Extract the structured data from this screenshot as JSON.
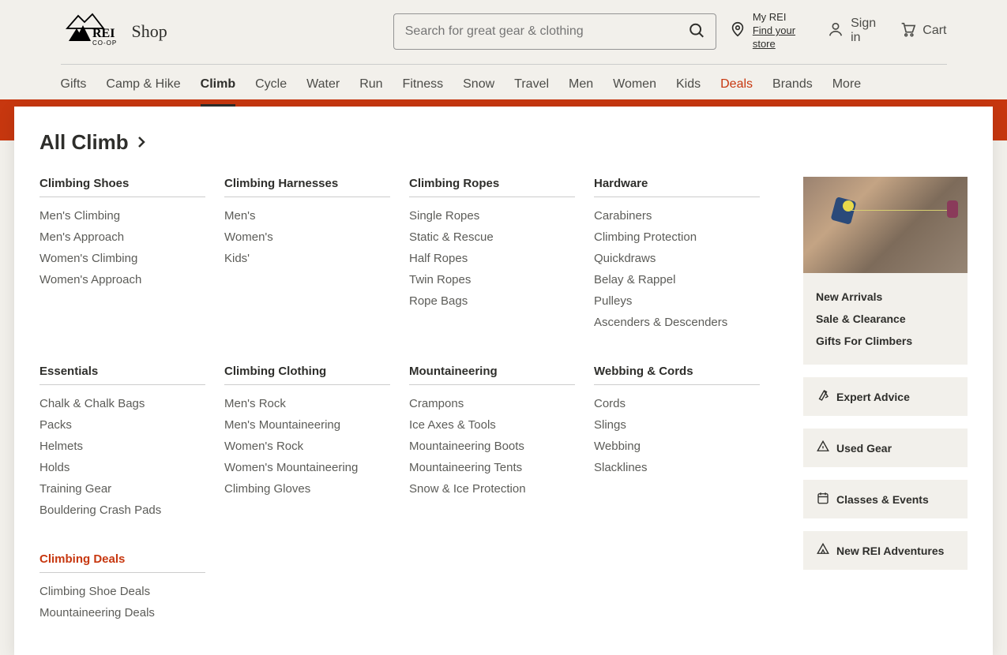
{
  "header": {
    "shop": "Shop",
    "search_placeholder": "Search for great gear & clothing",
    "my_rei": "My REI",
    "find_store": "Find your store",
    "sign_in": "Sign in",
    "cart": "Cart"
  },
  "nav": [
    "Gifts",
    "Camp & Hike",
    "Climb",
    "Cycle",
    "Water",
    "Run",
    "Fitness",
    "Snow",
    "Travel",
    "Men",
    "Women",
    "Kids",
    "Deals",
    "Brands",
    "More"
  ],
  "nav_active": "Climb",
  "nav_deals_label": "Deals",
  "mega": {
    "title": "All Climb",
    "columns": [
      {
        "heading": "Climbing Shoes",
        "links": [
          "Men's Climbing",
          "Men's Approach",
          "Women's Climbing",
          "Women's Approach"
        ]
      },
      {
        "heading": "Climbing Harnesses",
        "links": [
          "Men's",
          "Women's",
          "Kids'"
        ]
      },
      {
        "heading": "Climbing Ropes",
        "links": [
          "Single Ropes",
          "Static & Rescue",
          "Half Ropes",
          "Twin Ropes",
          "Rope Bags"
        ]
      },
      {
        "heading": "Hardware",
        "links": [
          "Carabiners",
          "Climbing Protection",
          "Quickdraws",
          "Belay & Rappel",
          "Pulleys",
          "Ascenders & Descenders"
        ]
      },
      {
        "heading": "Essentials",
        "links": [
          "Chalk & Chalk Bags",
          "Packs",
          "Helmets",
          "Holds",
          "Training Gear",
          "Bouldering Crash Pads"
        ]
      },
      {
        "heading": "Climbing Clothing",
        "links": [
          "Men's Rock",
          "Men's Mountaineering",
          "Women's Rock",
          "Women's Mountaineering",
          "Climbing Gloves"
        ]
      },
      {
        "heading": "Mountaineering",
        "links": [
          "Crampons",
          "Ice Axes & Tools",
          "Mountaineering Boots",
          "Mountaineering Tents",
          "Snow & Ice Protection"
        ]
      },
      {
        "heading": "Webbing & Cords",
        "links": [
          "Cords",
          "Slings",
          "Webbing",
          "Slacklines"
        ]
      },
      {
        "heading": "Climbing Deals",
        "deals": true,
        "links": [
          "Climbing Shoe Deals",
          "Mountaineering Deals"
        ]
      }
    ],
    "promo_links": [
      "New Arrivals",
      "Sale & Clearance",
      "Gifts For Climbers"
    ],
    "side_buttons": [
      "Expert Advice",
      "Used Gear",
      "Classes & Events",
      "New REI Adventures"
    ]
  }
}
